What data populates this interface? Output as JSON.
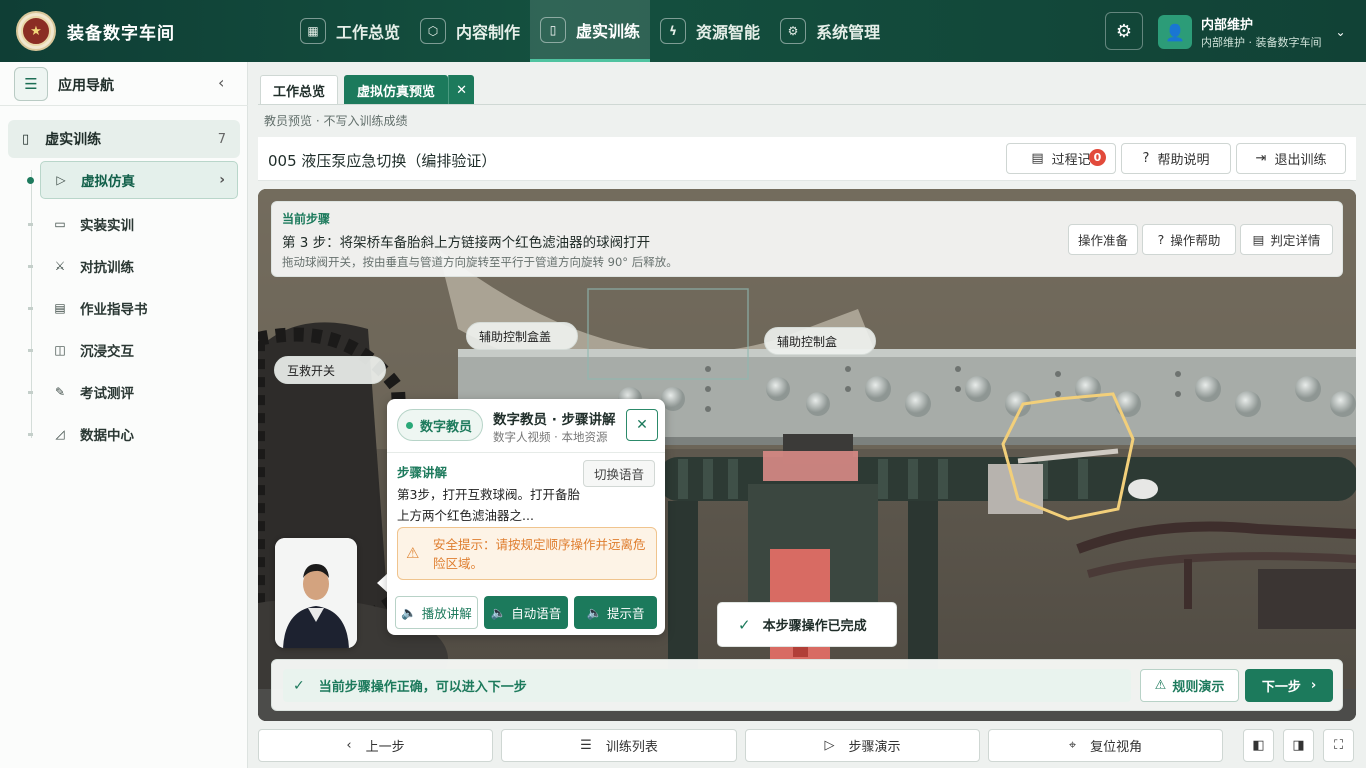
{
  "app": {
    "title": "装备数字车间"
  },
  "nav": [
    {
      "label": "工作总览",
      "icon": "grid-icon",
      "active": false
    },
    {
      "label": "内容制作",
      "icon": "cube-icon",
      "active": false
    },
    {
      "label": "虚实训练",
      "icon": "book-icon",
      "active": true
    },
    {
      "label": "资源智能",
      "icon": "plug-icon",
      "active": false
    },
    {
      "label": "系统管理",
      "icon": "gear-icon",
      "active": false
    }
  ],
  "user": {
    "name": "内部维护",
    "role": "内部维护 · 装备数字车间"
  },
  "sidebar": {
    "title": "应用导航",
    "group": {
      "label": "虚实训练",
      "count": "7"
    },
    "items": [
      {
        "label": "虚拟仿真",
        "icon": "play-circle-icon",
        "active": true
      },
      {
        "label": "实装实训",
        "icon": "monitor-icon",
        "active": false
      },
      {
        "label": "对抗训练",
        "icon": "fight-icon",
        "active": false
      },
      {
        "label": "作业指导书",
        "icon": "document-icon",
        "active": false
      },
      {
        "label": "沉浸交互",
        "icon": "vr-icon",
        "active": false
      },
      {
        "label": "考试测评",
        "icon": "exam-icon",
        "active": false
      },
      {
        "label": "数据中心",
        "icon": "chart-icon",
        "active": false
      }
    ]
  },
  "tabs": [
    {
      "label": "工作总览",
      "active": false
    },
    {
      "label": "虚拟仿真预览",
      "active": true
    }
  ],
  "preview_note": "教员预览 · 不写入训练成绩",
  "page": {
    "title": "005 液压泵应急切换（编排验证）",
    "buttons": {
      "record": "过程记",
      "record_badge": "0",
      "help": "帮助说明",
      "exit": "退出训练"
    }
  },
  "step": {
    "label": "当前步骤",
    "text": "第 3 步：将架桥车备胎斜上方链接两个红色滤油器的球阀打开",
    "hint": "拖动球阀开关，按由垂直与管道方向旋转至平行于管道方向旋转 90° 后释放。",
    "buttons": {
      "prepare": "操作准备",
      "help": "操作帮助",
      "judge": "判定详情"
    }
  },
  "scene_labels": {
    "aux_cover": "辅助控制盒盖",
    "aux_box": "辅助控制盒",
    "rescue_switch": "互救开关"
  },
  "tutor": {
    "badge": "数字教员",
    "name": "数字教员 · 步骤讲解",
    "sub": "数字人视频 · 本地资源",
    "section": "步骤讲解",
    "switch_voice": "切换语音",
    "text": "第3步，打开互救球阀。打开备胎上方两个红色滤油器之...",
    "warning": "安全提示：请按规定顺序操作并远离危险区域。",
    "buttons": {
      "play": "播放讲解",
      "auto_voice": "自动语音",
      "tone": "提示音"
    }
  },
  "done_toast": "本步骤操作已完成",
  "status": {
    "text": "当前步骤操作正确，可以进入下一步",
    "rule_demo": "规则演示",
    "next": "下一步"
  },
  "bottom": {
    "prev": "上一步",
    "list": "训练列表",
    "demo": "步骤演示",
    "reset": "复位视角"
  }
}
